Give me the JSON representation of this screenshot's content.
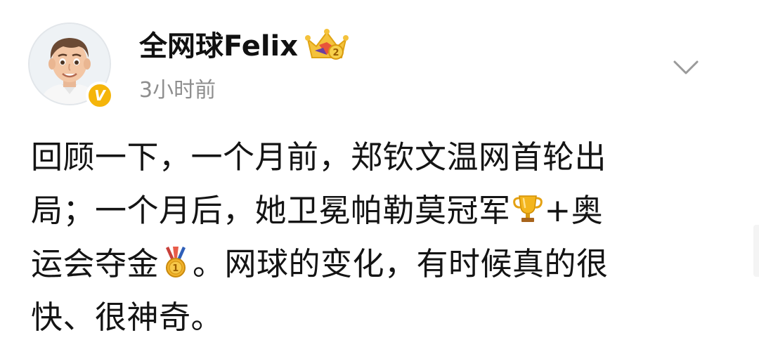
{
  "header": {
    "user_name": "全网球Felix",
    "post_time": "3小时前",
    "verified_badge": "V",
    "crown_badge_number": "2",
    "icons": {
      "avatar": "cartoon-avatar",
      "verified": "verified-badge-icon",
      "crown": "crown-icon",
      "more": "chevron-down-icon"
    }
  },
  "post": {
    "lines": [
      {
        "text": "回顾一下，一个月前，郑钦文温网首轮出"
      },
      {
        "text_before": "局；一个月后，她卫冕帕勒莫冠军",
        "emoji": "trophy-emoji",
        "text_after": "+奥"
      },
      {
        "text_before": "运会夺金",
        "emoji": "gold-medal-emoji",
        "text_after": "。网球的变化，有时候真的很"
      },
      {
        "text": "快、很神奇。"
      }
    ],
    "medal_number": "1"
  },
  "colors": {
    "verified": "#f5b50a",
    "time_text": "#8e8e8e",
    "body_text": "#141414"
  }
}
